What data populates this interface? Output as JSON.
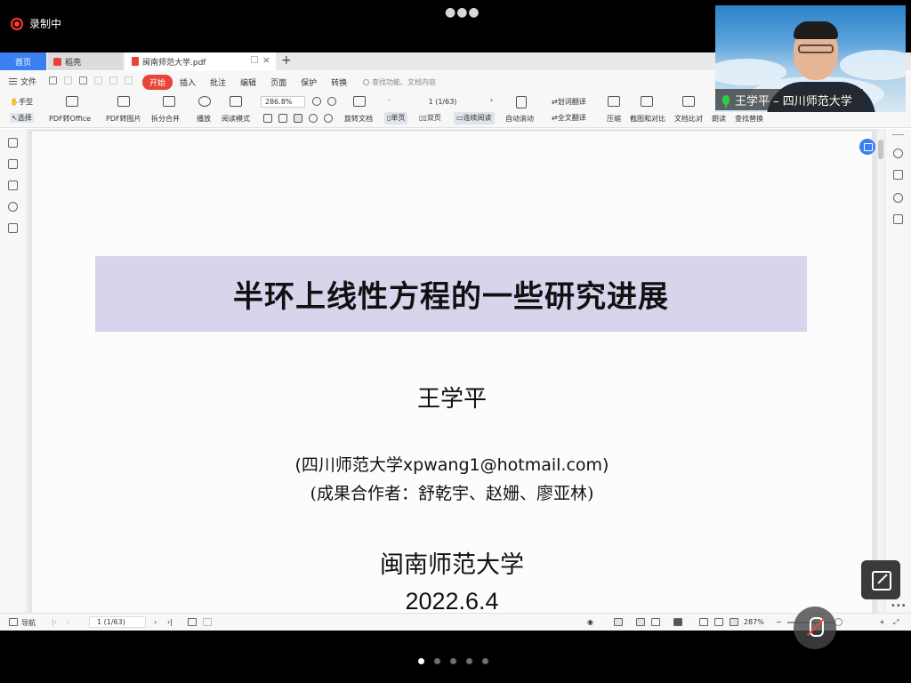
{
  "recording": {
    "label": "录制中"
  },
  "tabs": [
    {
      "label": "首页"
    },
    {
      "label": "稻壳"
    },
    {
      "label": "闽南师范大学.pdf"
    }
  ],
  "menu": {
    "file": "文件",
    "tabs": [
      "开始",
      "插入",
      "批注",
      "编辑",
      "页面",
      "保护",
      "转换"
    ],
    "search_placeholder": "查找功能、文档内容"
  },
  "ribbon": {
    "hand": "手型",
    "select": "选择",
    "pdf_to_office": "PDF转Office",
    "pdf_to_image": "PDF转图片",
    "split_merge": "拆分合并",
    "play": "播放",
    "read_mode": "阅读模式",
    "zoom": "286.8%",
    "rotate": "旋转文档",
    "page_indicator": "1 (1/63)",
    "single_page": "单页",
    "double_page": "双页",
    "continuous": "连续阅读",
    "auto_scroll": "自动滚动",
    "word_translate": "划词翻译",
    "full_translate": "全文翻译",
    "compress": "压缩",
    "screenshot_compare": "截图和对比",
    "doc_compare": "文档比对",
    "read_aloud": "朗读",
    "find_replace": "查找替换"
  },
  "slide": {
    "title": "半环上线性方程的一些研究进展",
    "author": "王学平",
    "affiliation": "(四川师范大学xpwang1@hotmail.com)",
    "coauthors": "(成果合作者：舒乾宇、赵姗、廖亚林)",
    "institution": "闽南师范大学",
    "date": "2022.6.4"
  },
  "statusbar": {
    "nav": "导航",
    "page": "1 (1/63)",
    "zoom": "287%"
  },
  "video": {
    "name": "王学平 – 四川师范大学"
  },
  "colors": {
    "accent": "#3b7ff0",
    "brand_red": "#e8443a",
    "title_bg": "#d6d5ec"
  },
  "pager": {
    "count": 5,
    "active": 1
  }
}
